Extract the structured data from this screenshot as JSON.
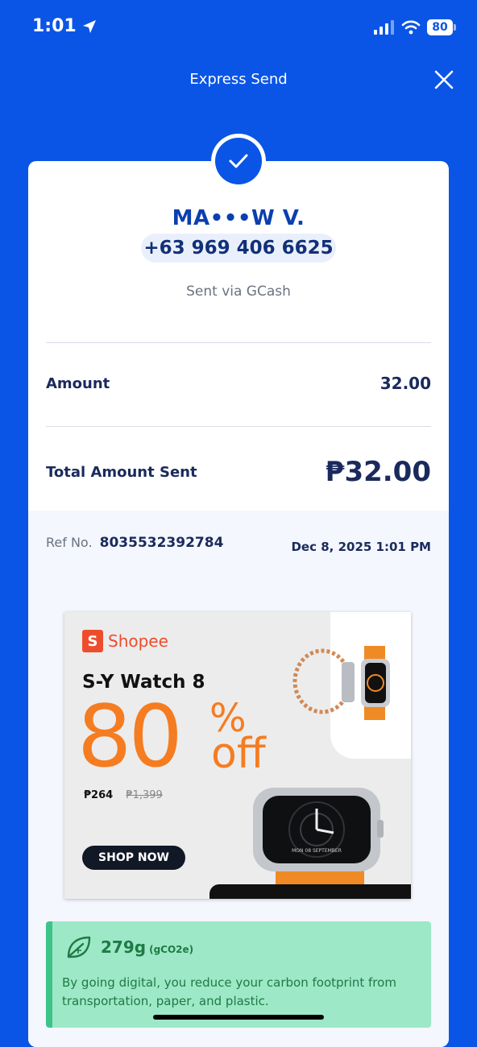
{
  "status_bar": {
    "time": "1:01",
    "battery": "80"
  },
  "header": {
    "title": "Express Send"
  },
  "receipt": {
    "recipient_name": "MA•••W V.",
    "recipient_phone": "+63 969 406 6625",
    "sent_via": "Sent via GCash",
    "amount_label": "Amount",
    "amount_value": "32.00",
    "total_label": "Total Amount Sent",
    "total_value": "₱32.00",
    "ref_label": "Ref No.",
    "ref_number": "8035532392784",
    "datetime": "Dec 8, 2025 1:01 PM"
  },
  "ad": {
    "brand": "Shopee",
    "brand_initial": "S",
    "product": "S-Y Watch 8",
    "discount": "80",
    "percent": "%",
    "off": "off",
    "price_new": "₱264",
    "price_old": "₱1,399",
    "cta": "SHOP NOW",
    "watch_face_text": "MON 08 SEPTEMBER"
  },
  "carbon": {
    "amount": "279g",
    "unit": "(gCO2e)",
    "message": "By going digital, you reduce your carbon footprint from transportation, paper, and plastic."
  },
  "colors": {
    "brand_blue": "#0a55e6",
    "shopee_orange": "#ee4d2d",
    "promo_orange": "#f57c20",
    "carbon_green": "#9de8c7"
  }
}
